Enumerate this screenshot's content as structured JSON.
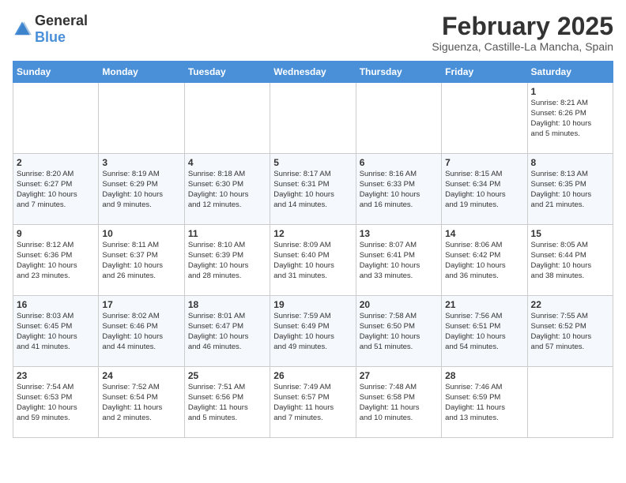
{
  "header": {
    "logo_general": "General",
    "logo_blue": "Blue",
    "title": "February 2025",
    "subtitle": "Siguenza, Castille-La Mancha, Spain"
  },
  "calendar": {
    "days_of_week": [
      "Sunday",
      "Monday",
      "Tuesday",
      "Wednesday",
      "Thursday",
      "Friday",
      "Saturday"
    ],
    "weeks": [
      [
        {
          "day": "",
          "info": ""
        },
        {
          "day": "",
          "info": ""
        },
        {
          "day": "",
          "info": ""
        },
        {
          "day": "",
          "info": ""
        },
        {
          "day": "",
          "info": ""
        },
        {
          "day": "",
          "info": ""
        },
        {
          "day": "1",
          "info": "Sunrise: 8:21 AM\nSunset: 6:26 PM\nDaylight: 10 hours\nand 5 minutes."
        }
      ],
      [
        {
          "day": "2",
          "info": "Sunrise: 8:20 AM\nSunset: 6:27 PM\nDaylight: 10 hours\nand 7 minutes."
        },
        {
          "day": "3",
          "info": "Sunrise: 8:19 AM\nSunset: 6:29 PM\nDaylight: 10 hours\nand 9 minutes."
        },
        {
          "day": "4",
          "info": "Sunrise: 8:18 AM\nSunset: 6:30 PM\nDaylight: 10 hours\nand 12 minutes."
        },
        {
          "day": "5",
          "info": "Sunrise: 8:17 AM\nSunset: 6:31 PM\nDaylight: 10 hours\nand 14 minutes."
        },
        {
          "day": "6",
          "info": "Sunrise: 8:16 AM\nSunset: 6:33 PM\nDaylight: 10 hours\nand 16 minutes."
        },
        {
          "day": "7",
          "info": "Sunrise: 8:15 AM\nSunset: 6:34 PM\nDaylight: 10 hours\nand 19 minutes."
        },
        {
          "day": "8",
          "info": "Sunrise: 8:13 AM\nSunset: 6:35 PM\nDaylight: 10 hours\nand 21 minutes."
        }
      ],
      [
        {
          "day": "9",
          "info": "Sunrise: 8:12 AM\nSunset: 6:36 PM\nDaylight: 10 hours\nand 23 minutes."
        },
        {
          "day": "10",
          "info": "Sunrise: 8:11 AM\nSunset: 6:37 PM\nDaylight: 10 hours\nand 26 minutes."
        },
        {
          "day": "11",
          "info": "Sunrise: 8:10 AM\nSunset: 6:39 PM\nDaylight: 10 hours\nand 28 minutes."
        },
        {
          "day": "12",
          "info": "Sunrise: 8:09 AM\nSunset: 6:40 PM\nDaylight: 10 hours\nand 31 minutes."
        },
        {
          "day": "13",
          "info": "Sunrise: 8:07 AM\nSunset: 6:41 PM\nDaylight: 10 hours\nand 33 minutes."
        },
        {
          "day": "14",
          "info": "Sunrise: 8:06 AM\nSunset: 6:42 PM\nDaylight: 10 hours\nand 36 minutes."
        },
        {
          "day": "15",
          "info": "Sunrise: 8:05 AM\nSunset: 6:44 PM\nDaylight: 10 hours\nand 38 minutes."
        }
      ],
      [
        {
          "day": "16",
          "info": "Sunrise: 8:03 AM\nSunset: 6:45 PM\nDaylight: 10 hours\nand 41 minutes."
        },
        {
          "day": "17",
          "info": "Sunrise: 8:02 AM\nSunset: 6:46 PM\nDaylight: 10 hours\nand 44 minutes."
        },
        {
          "day": "18",
          "info": "Sunrise: 8:01 AM\nSunset: 6:47 PM\nDaylight: 10 hours\nand 46 minutes."
        },
        {
          "day": "19",
          "info": "Sunrise: 7:59 AM\nSunset: 6:49 PM\nDaylight: 10 hours\nand 49 minutes."
        },
        {
          "day": "20",
          "info": "Sunrise: 7:58 AM\nSunset: 6:50 PM\nDaylight: 10 hours\nand 51 minutes."
        },
        {
          "day": "21",
          "info": "Sunrise: 7:56 AM\nSunset: 6:51 PM\nDaylight: 10 hours\nand 54 minutes."
        },
        {
          "day": "22",
          "info": "Sunrise: 7:55 AM\nSunset: 6:52 PM\nDaylight: 10 hours\nand 57 minutes."
        }
      ],
      [
        {
          "day": "23",
          "info": "Sunrise: 7:54 AM\nSunset: 6:53 PM\nDaylight: 10 hours\nand 59 minutes."
        },
        {
          "day": "24",
          "info": "Sunrise: 7:52 AM\nSunset: 6:54 PM\nDaylight: 11 hours\nand 2 minutes."
        },
        {
          "day": "25",
          "info": "Sunrise: 7:51 AM\nSunset: 6:56 PM\nDaylight: 11 hours\nand 5 minutes."
        },
        {
          "day": "26",
          "info": "Sunrise: 7:49 AM\nSunset: 6:57 PM\nDaylight: 11 hours\nand 7 minutes."
        },
        {
          "day": "27",
          "info": "Sunrise: 7:48 AM\nSunset: 6:58 PM\nDaylight: 11 hours\nand 10 minutes."
        },
        {
          "day": "28",
          "info": "Sunrise: 7:46 AM\nSunset: 6:59 PM\nDaylight: 11 hours\nand 13 minutes."
        },
        {
          "day": "",
          "info": ""
        }
      ]
    ]
  }
}
